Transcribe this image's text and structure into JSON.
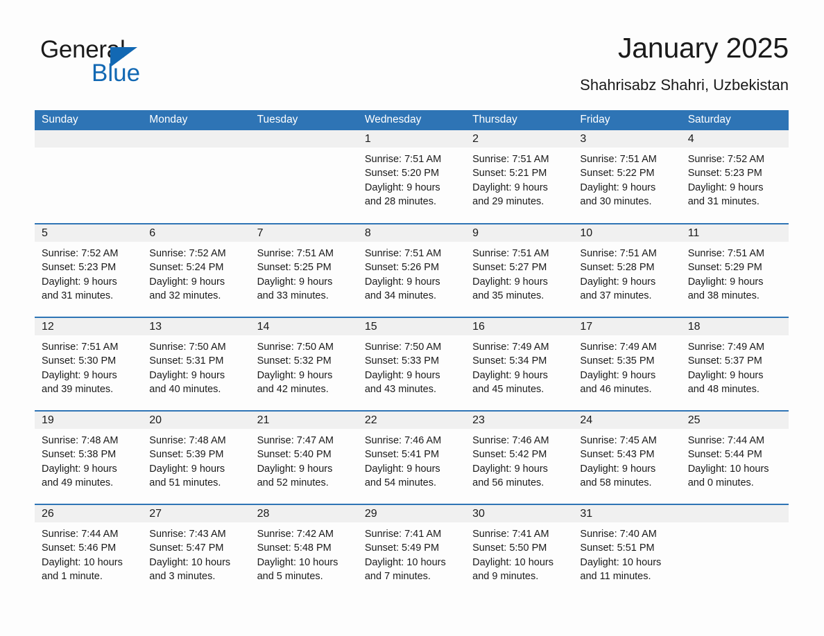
{
  "brand": {
    "word1": "General",
    "word2": "Blue",
    "triangle_color": "#1268b3",
    "text_color": "#1a1a1a"
  },
  "header": {
    "title": "January 2025",
    "subtitle": "Shahrisabz Shahri, Uzbekistan"
  },
  "theme": {
    "header_blue": "#2e74b5",
    "row_rule_blue": "#2e74b5",
    "daynum_band": "#f0f0f0",
    "page_bg": "#fdfdfd"
  },
  "weekdays": [
    "Sunday",
    "Monday",
    "Tuesday",
    "Wednesday",
    "Thursday",
    "Friday",
    "Saturday"
  ],
  "weeks": [
    [
      {
        "day": "",
        "sunrise": "",
        "sunset": "",
        "daylight1": "",
        "daylight2": ""
      },
      {
        "day": "",
        "sunrise": "",
        "sunset": "",
        "daylight1": "",
        "daylight2": ""
      },
      {
        "day": "",
        "sunrise": "",
        "sunset": "",
        "daylight1": "",
        "daylight2": ""
      },
      {
        "day": "1",
        "sunrise": "Sunrise: 7:51 AM",
        "sunset": "Sunset: 5:20 PM",
        "daylight1": "Daylight: 9 hours",
        "daylight2": "and 28 minutes."
      },
      {
        "day": "2",
        "sunrise": "Sunrise: 7:51 AM",
        "sunset": "Sunset: 5:21 PM",
        "daylight1": "Daylight: 9 hours",
        "daylight2": "and 29 minutes."
      },
      {
        "day": "3",
        "sunrise": "Sunrise: 7:51 AM",
        "sunset": "Sunset: 5:22 PM",
        "daylight1": "Daylight: 9 hours",
        "daylight2": "and 30 minutes."
      },
      {
        "day": "4",
        "sunrise": "Sunrise: 7:52 AM",
        "sunset": "Sunset: 5:23 PM",
        "daylight1": "Daylight: 9 hours",
        "daylight2": "and 31 minutes."
      }
    ],
    [
      {
        "day": "5",
        "sunrise": "Sunrise: 7:52 AM",
        "sunset": "Sunset: 5:23 PM",
        "daylight1": "Daylight: 9 hours",
        "daylight2": "and 31 minutes."
      },
      {
        "day": "6",
        "sunrise": "Sunrise: 7:52 AM",
        "sunset": "Sunset: 5:24 PM",
        "daylight1": "Daylight: 9 hours",
        "daylight2": "and 32 minutes."
      },
      {
        "day": "7",
        "sunrise": "Sunrise: 7:51 AM",
        "sunset": "Sunset: 5:25 PM",
        "daylight1": "Daylight: 9 hours",
        "daylight2": "and 33 minutes."
      },
      {
        "day": "8",
        "sunrise": "Sunrise: 7:51 AM",
        "sunset": "Sunset: 5:26 PM",
        "daylight1": "Daylight: 9 hours",
        "daylight2": "and 34 minutes."
      },
      {
        "day": "9",
        "sunrise": "Sunrise: 7:51 AM",
        "sunset": "Sunset: 5:27 PM",
        "daylight1": "Daylight: 9 hours",
        "daylight2": "and 35 minutes."
      },
      {
        "day": "10",
        "sunrise": "Sunrise: 7:51 AM",
        "sunset": "Sunset: 5:28 PM",
        "daylight1": "Daylight: 9 hours",
        "daylight2": "and 37 minutes."
      },
      {
        "day": "11",
        "sunrise": "Sunrise: 7:51 AM",
        "sunset": "Sunset: 5:29 PM",
        "daylight1": "Daylight: 9 hours",
        "daylight2": "and 38 minutes."
      }
    ],
    [
      {
        "day": "12",
        "sunrise": "Sunrise: 7:51 AM",
        "sunset": "Sunset: 5:30 PM",
        "daylight1": "Daylight: 9 hours",
        "daylight2": "and 39 minutes."
      },
      {
        "day": "13",
        "sunrise": "Sunrise: 7:50 AM",
        "sunset": "Sunset: 5:31 PM",
        "daylight1": "Daylight: 9 hours",
        "daylight2": "and 40 minutes."
      },
      {
        "day": "14",
        "sunrise": "Sunrise: 7:50 AM",
        "sunset": "Sunset: 5:32 PM",
        "daylight1": "Daylight: 9 hours",
        "daylight2": "and 42 minutes."
      },
      {
        "day": "15",
        "sunrise": "Sunrise: 7:50 AM",
        "sunset": "Sunset: 5:33 PM",
        "daylight1": "Daylight: 9 hours",
        "daylight2": "and 43 minutes."
      },
      {
        "day": "16",
        "sunrise": "Sunrise: 7:49 AM",
        "sunset": "Sunset: 5:34 PM",
        "daylight1": "Daylight: 9 hours",
        "daylight2": "and 45 minutes."
      },
      {
        "day": "17",
        "sunrise": "Sunrise: 7:49 AM",
        "sunset": "Sunset: 5:35 PM",
        "daylight1": "Daylight: 9 hours",
        "daylight2": "and 46 minutes."
      },
      {
        "day": "18",
        "sunrise": "Sunrise: 7:49 AM",
        "sunset": "Sunset: 5:37 PM",
        "daylight1": "Daylight: 9 hours",
        "daylight2": "and 48 minutes."
      }
    ],
    [
      {
        "day": "19",
        "sunrise": "Sunrise: 7:48 AM",
        "sunset": "Sunset: 5:38 PM",
        "daylight1": "Daylight: 9 hours",
        "daylight2": "and 49 minutes."
      },
      {
        "day": "20",
        "sunrise": "Sunrise: 7:48 AM",
        "sunset": "Sunset: 5:39 PM",
        "daylight1": "Daylight: 9 hours",
        "daylight2": "and 51 minutes."
      },
      {
        "day": "21",
        "sunrise": "Sunrise: 7:47 AM",
        "sunset": "Sunset: 5:40 PM",
        "daylight1": "Daylight: 9 hours",
        "daylight2": "and 52 minutes."
      },
      {
        "day": "22",
        "sunrise": "Sunrise: 7:46 AM",
        "sunset": "Sunset: 5:41 PM",
        "daylight1": "Daylight: 9 hours",
        "daylight2": "and 54 minutes."
      },
      {
        "day": "23",
        "sunrise": "Sunrise: 7:46 AM",
        "sunset": "Sunset: 5:42 PM",
        "daylight1": "Daylight: 9 hours",
        "daylight2": "and 56 minutes."
      },
      {
        "day": "24",
        "sunrise": "Sunrise: 7:45 AM",
        "sunset": "Sunset: 5:43 PM",
        "daylight1": "Daylight: 9 hours",
        "daylight2": "and 58 minutes."
      },
      {
        "day": "25",
        "sunrise": "Sunrise: 7:44 AM",
        "sunset": "Sunset: 5:44 PM",
        "daylight1": "Daylight: 10 hours",
        "daylight2": "and 0 minutes."
      }
    ],
    [
      {
        "day": "26",
        "sunrise": "Sunrise: 7:44 AM",
        "sunset": "Sunset: 5:46 PM",
        "daylight1": "Daylight: 10 hours",
        "daylight2": "and 1 minute."
      },
      {
        "day": "27",
        "sunrise": "Sunrise: 7:43 AM",
        "sunset": "Sunset: 5:47 PM",
        "daylight1": "Daylight: 10 hours",
        "daylight2": "and 3 minutes."
      },
      {
        "day": "28",
        "sunrise": "Sunrise: 7:42 AM",
        "sunset": "Sunset: 5:48 PM",
        "daylight1": "Daylight: 10 hours",
        "daylight2": "and 5 minutes."
      },
      {
        "day": "29",
        "sunrise": "Sunrise: 7:41 AM",
        "sunset": "Sunset: 5:49 PM",
        "daylight1": "Daylight: 10 hours",
        "daylight2": "and 7 minutes."
      },
      {
        "day": "30",
        "sunrise": "Sunrise: 7:41 AM",
        "sunset": "Sunset: 5:50 PM",
        "daylight1": "Daylight: 10 hours",
        "daylight2": "and 9 minutes."
      },
      {
        "day": "31",
        "sunrise": "Sunrise: 7:40 AM",
        "sunset": "Sunset: 5:51 PM",
        "daylight1": "Daylight: 10 hours",
        "daylight2": "and 11 minutes."
      },
      {
        "day": "",
        "sunrise": "",
        "sunset": "",
        "daylight1": "",
        "daylight2": ""
      }
    ]
  ]
}
